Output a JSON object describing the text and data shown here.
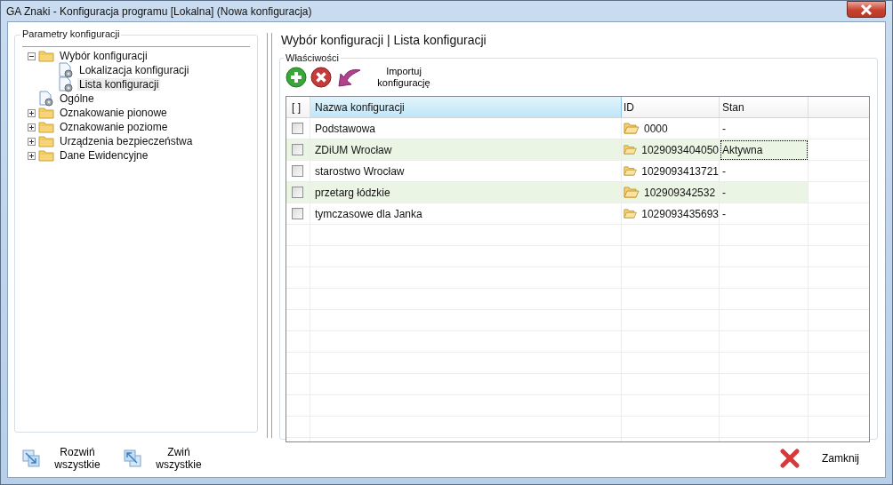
{
  "window": {
    "title": "GA Znaki - Konfiguracja programu [Lokalna] (Nowa konfiguracja)"
  },
  "tree": {
    "title": "Parametry konfiguracji",
    "items": [
      {
        "label": "Wybór konfiguracji",
        "kind": "folder",
        "expanded": true,
        "selected": false,
        "children": [
          {
            "label": "Lokalizacja konfiguracji",
            "kind": "page",
            "selected": false
          },
          {
            "label": "Lista konfiguracji",
            "kind": "page",
            "selected": true
          }
        ]
      },
      {
        "label": "Ogólne",
        "kind": "page",
        "selected": false
      },
      {
        "label": "Oznakowanie pionowe",
        "kind": "folder",
        "expanded": false,
        "selected": false
      },
      {
        "label": "Oznakowanie poziome",
        "kind": "folder",
        "expanded": false,
        "selected": false
      },
      {
        "label": "Urządzenia bezpieczeństwa",
        "kind": "folder",
        "expanded": false,
        "selected": false
      },
      {
        "label": "Dane Ewidencyjne",
        "kind": "folder",
        "expanded": false,
        "selected": false
      }
    ]
  },
  "breadcrumb": "Wybór konfiguracji | Lista konfiguracji",
  "properties": {
    "title": "Właściwości",
    "import_label": "Importuj konfigurację"
  },
  "table": {
    "columns": [
      "[ ]",
      "Nazwa konfiguracji",
      "ID",
      "Stan"
    ],
    "rows": [
      {
        "checked": false,
        "name": "Podstawowa",
        "id": "0000",
        "status": "-",
        "focused": false
      },
      {
        "checked": false,
        "name": "ZDiUM Wrocław",
        "id": "1029093404050",
        "status": "Aktywna",
        "focused": true
      },
      {
        "checked": false,
        "name": "starostwo Wrocław",
        "id": "1029093413721",
        "status": "-",
        "focused": false
      },
      {
        "checked": false,
        "name": "przetarg łódzkie",
        "id": "102909342532",
        "status": "-",
        "focused": false
      },
      {
        "checked": false,
        "name": "tymczasowe dla Janka",
        "id": "1029093435693",
        "status": "-",
        "focused": false
      }
    ]
  },
  "buttons": {
    "expand_all": "Rozwiń wszystkie",
    "collapse_all": "Zwiń wszystkie",
    "close": "Zamknij"
  }
}
